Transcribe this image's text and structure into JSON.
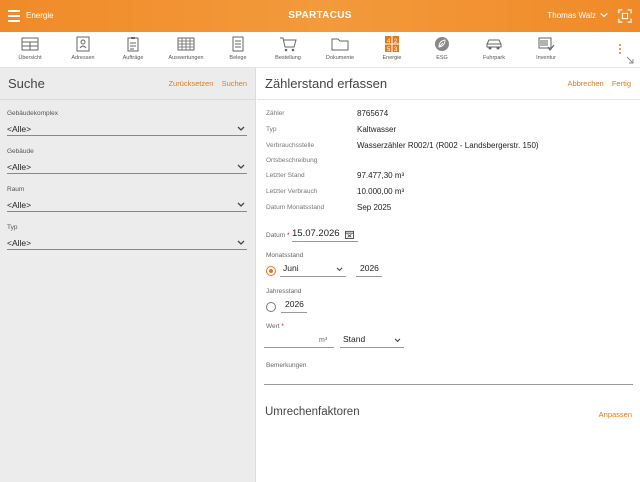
{
  "header": {
    "module": "Energie",
    "title": "SPARTACUS",
    "user": "Thomas Walz"
  },
  "toolbar": [
    {
      "label": "Übersicht",
      "icon": "overview-icon"
    },
    {
      "label": "Adressen",
      "icon": "address-icon"
    },
    {
      "label": "Aufträge",
      "icon": "clipboard-icon"
    },
    {
      "label": "Auswertungen",
      "icon": "table-icon"
    },
    {
      "label": "Belege",
      "icon": "document-icon"
    },
    {
      "label": "Bestellung",
      "icon": "cart-icon"
    },
    {
      "label": "Dokumente",
      "icon": "folder-icon"
    },
    {
      "label": "Energie",
      "icon": "energy-icon"
    },
    {
      "label": "ESG",
      "icon": "leaf-icon"
    },
    {
      "label": "Fuhrpark",
      "icon": "car-icon"
    },
    {
      "label": "Inventur",
      "icon": "inventory-icon"
    }
  ],
  "search": {
    "title": "Suche",
    "reset_label": "Zurücksetzen",
    "search_label": "Suchen",
    "filters": [
      {
        "label": "Gebäudekomplex",
        "value": "<Alle>"
      },
      {
        "label": "Gebäude",
        "value": "<Alle>"
      },
      {
        "label": "Raum",
        "value": "<Alle>"
      },
      {
        "label": "Typ",
        "value": "<Alle>"
      }
    ]
  },
  "form": {
    "title": "Zählerstand erfassen",
    "cancel_label": "Abbrechen",
    "done_label": "Fertig",
    "info": [
      {
        "label": "Zähler",
        "value": "8765674"
      },
      {
        "label": "Typ",
        "value": "Kaltwasser"
      },
      {
        "label": "Verbrauchsstelle",
        "value": "Wasserzähler R002/1 (R002 - Landsbergerstr. 150)"
      },
      {
        "label": "Ortsbeschreibung",
        "value": ""
      },
      {
        "label": "Letzter Stand",
        "value": "97.477,30 m³"
      },
      {
        "label": "Letzter Verbrauch",
        "value": "10.000,00 m³"
      },
      {
        "label": "Datum Monatsstand",
        "value": "Sep 2025"
      }
    ],
    "date_label": "Datum",
    "date_value": "15.07.2026",
    "month_label": "Monatsstand",
    "month_value": "Juni",
    "month_year": "2026",
    "year_label": "Jahresstand",
    "year_value": "2026",
    "wert_label": "Wert",
    "wert_unit": "m³",
    "wert_type": "Stand",
    "remarks_label": "Bemerkungen",
    "required_mark": "*"
  },
  "factors": {
    "title": "Umrechenfaktoren",
    "action_label": "Anpassen"
  },
  "colors": {
    "accent": "#e07b1c",
    "header": "#f08a28"
  }
}
